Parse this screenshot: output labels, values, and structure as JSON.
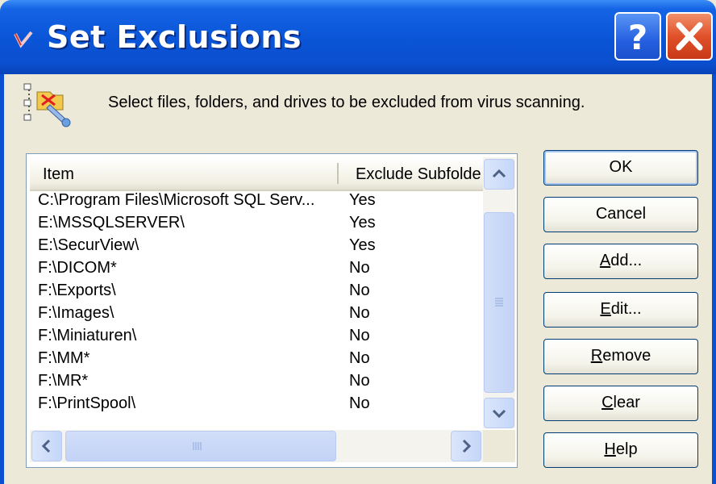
{
  "window": {
    "title": "Set Exclusions",
    "help_button": "?",
    "close_button": "X"
  },
  "description": "Select files, folders, and drives to be excluded from virus scanning.",
  "list": {
    "columns": [
      "Item",
      "Exclude Subfolde"
    ],
    "rows": [
      {
        "item": "C:\\Program Files\\Microsoft SQL Serv...",
        "exclude": "Yes"
      },
      {
        "item": "E:\\MSSQLSERVER\\",
        "exclude": "Yes"
      },
      {
        "item": "E:\\SecurView\\",
        "exclude": "Yes"
      },
      {
        "item": "F:\\DICOM*",
        "exclude": "No"
      },
      {
        "item": "F:\\Exports\\",
        "exclude": "No"
      },
      {
        "item": "F:\\Images\\",
        "exclude": "No"
      },
      {
        "item": "F:\\Miniaturen\\",
        "exclude": "No"
      },
      {
        "item": "F:\\MM*",
        "exclude": "No"
      },
      {
        "item": "F:\\MR*",
        "exclude": "No"
      },
      {
        "item": "F:\\PrintSpool\\",
        "exclude": "No"
      }
    ]
  },
  "buttons": {
    "ok": "OK",
    "cancel": "Cancel",
    "add": {
      "mnemonic": "A",
      "rest": "dd..."
    },
    "edit": {
      "mnemonic": "E",
      "rest": "dit..."
    },
    "remove": {
      "mnemonic": "R",
      "rest": "emove"
    },
    "clear": {
      "mnemonic": "C",
      "rest": "lear"
    },
    "help": {
      "mnemonic": "H",
      "rest": "elp"
    }
  },
  "icons": {
    "app": "antivirus-shield-icon",
    "description": "folder-exclusion-tools-icon",
    "scroll_up": "chevron-up-icon",
    "scroll_down": "chevron-down-icon",
    "scroll_left": "chevron-left-icon",
    "scroll_right": "chevron-right-icon"
  },
  "colors": {
    "title_bar": "#0a55d8",
    "dialog_bg": "#ece9d8",
    "close_button": "#e0512a",
    "scrollbar": "#c5d6f9"
  }
}
